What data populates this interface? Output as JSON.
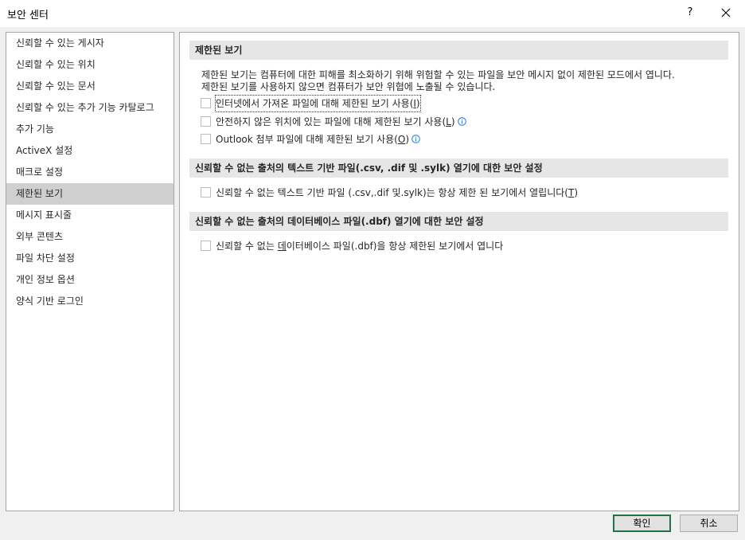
{
  "window": {
    "title": "보안 센터",
    "help_label": "?",
    "close_icon": "close-icon"
  },
  "sidebar": {
    "items": [
      {
        "label": "신뢰할 수 있는 게시자"
      },
      {
        "label": "신뢰할 수 있는 위치"
      },
      {
        "label": "신뢰할 수 있는 문서"
      },
      {
        "label": "신뢰할 수 있는 추가 기능 카탈로그"
      },
      {
        "label": "추가 기능"
      },
      {
        "label": "ActiveX 설정"
      },
      {
        "label": "매크로 설정"
      },
      {
        "label": "제한된 보기",
        "selected": true
      },
      {
        "label": "메시지 표시줄"
      },
      {
        "label": "외부 콘텐츠"
      },
      {
        "label": "파일 차단 설정"
      },
      {
        "label": "개인 정보 옵션"
      },
      {
        "label": "양식 기반 로그인"
      }
    ]
  },
  "protected_view": {
    "header": "제한된 보기",
    "desc_line1": "제한된 보기는 컴퓨터에 대한 피해를 최소화하기 위해 위험할 수 있는 파일을 보안 메시지 없이 제한된 모드에서 엽니다.",
    "desc_line2": "제한된 보기를 사용하지 않으면 컴퓨터가 보안 위협에 노출될 수 있습니다.",
    "options": [
      {
        "text": "인터넷에서 가져온 파일에 대해 제한된 보기 사용(",
        "key": "I",
        "suffix": ")",
        "checked": false,
        "info": false
      },
      {
        "text": "안전하지 않은 위치에 있는 파일에 대해 제한된 보기 사용(",
        "key": "L",
        "suffix": ")",
        "checked": false,
        "info": true
      },
      {
        "text": "Outlook 첨부 파일에 대해 제한된 보기 사용(",
        "key": "O",
        "suffix": ")",
        "checked": false,
        "info": true
      }
    ]
  },
  "text_files": {
    "header": "신뢰할 수 없는 출처의 텍스트 기반 파일(.csv, .dif 및 .sylk) 열기에 대한 보안 설정",
    "option_text": "신뢰할 수 없는 텍스트 기반 파일 (.csv,.dif 및.sylk)는 항상 제한 된 보기에서 열립니다(",
    "option_key": "T",
    "option_suffix": ")",
    "checked": false
  },
  "database_files": {
    "header": "신뢰할 수 없는 출처의 데이터베이스 파일(.dbf) 열기에 대한 보안 설정",
    "option_prefix": "신뢰할 수 없는 ",
    "option_key": "데",
    "option_rest": "이터베이스 파일(.dbf)을 항상 제한된 보기에서 엽니다",
    "checked": false
  },
  "buttons": {
    "ok": "확인",
    "cancel": "취소"
  },
  "colors": {
    "selected_nav": "#cfcfcf",
    "section_header": "#e6e6e6",
    "default_button_border": "#217346",
    "info_icon": "#2b79d8"
  }
}
